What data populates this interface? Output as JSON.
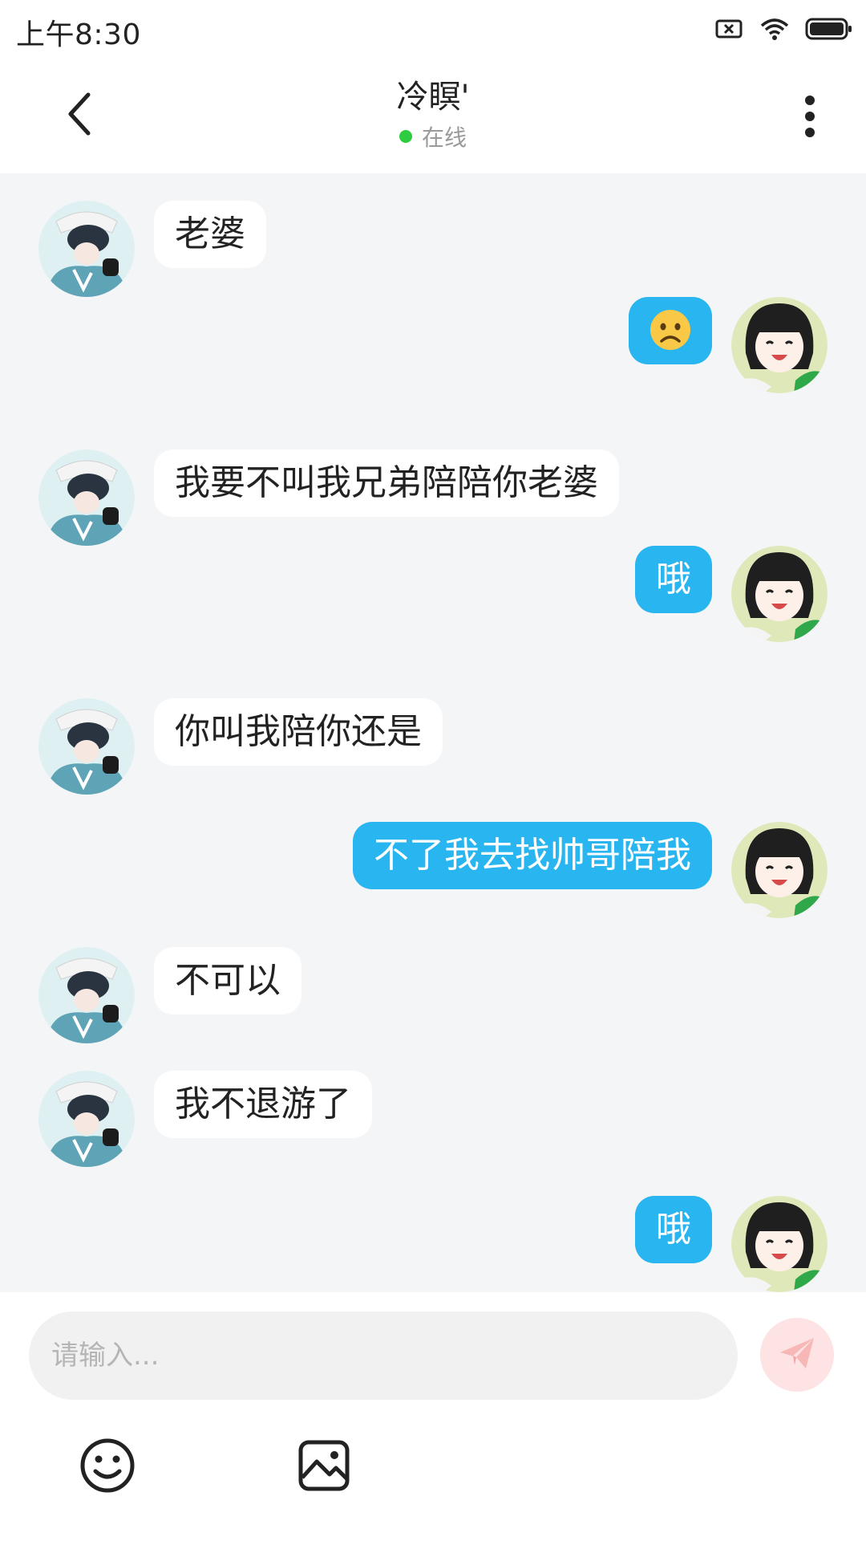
{
  "status_bar": {
    "time": "上午8:30"
  },
  "header": {
    "title": "冷瞑'",
    "status": "在线"
  },
  "messages": [
    {
      "side": "left",
      "text": "老婆"
    },
    {
      "side": "right",
      "text": "",
      "emoji": "frowning-face"
    },
    {
      "side": "left",
      "text": "我要不叫我兄弟陪陪你老婆"
    },
    {
      "side": "right",
      "text": "哦"
    },
    {
      "side": "left",
      "text": "你叫我陪你还是"
    },
    {
      "side": "right",
      "text": "不了我去找帅哥陪我"
    },
    {
      "side": "left",
      "text": "不可以"
    },
    {
      "side": "left",
      "text": "我不退游了"
    },
    {
      "side": "right",
      "text": "哦"
    }
  ],
  "composer": {
    "placeholder": "请输入...",
    "value": ""
  },
  "colors": {
    "own_bubble": "#29b5ef",
    "other_bubble": "#ffffff",
    "online": "#2ecc40",
    "send_button": "#fde3e3"
  },
  "icons": [
    "chevron-left-icon",
    "more-vertical-icon",
    "send-icon",
    "smiley-icon",
    "image-icon"
  ]
}
